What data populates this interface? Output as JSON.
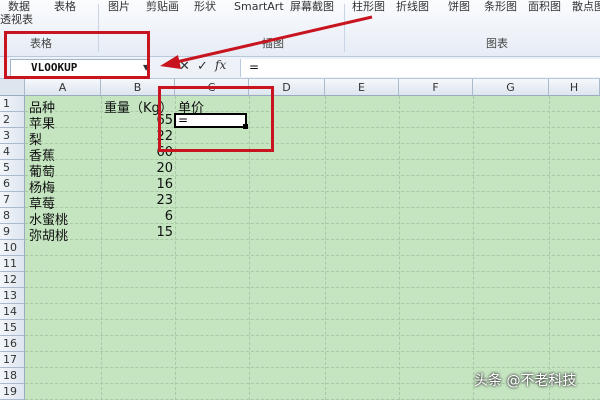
{
  "ribbon": {
    "items_row1": [
      "数据",
      "表格",
      "图片",
      "剪贴画",
      "形状",
      "SmartArt",
      "屏幕截图",
      "柱形图",
      "折线图",
      "饼图",
      "条形图",
      "面积图",
      "散点图"
    ],
    "items_row2": [
      "透视表"
    ],
    "groups": [
      "表格",
      "插图",
      "图表"
    ]
  },
  "formula_bar": {
    "name_box": "VLOOKUP",
    "cancel": "✕",
    "enter": "✓",
    "fx": "fx",
    "formula": "="
  },
  "sheet": {
    "columns": [
      "A",
      "B",
      "C",
      "D",
      "E",
      "F",
      "G",
      "H"
    ],
    "rows": [
      "1",
      "2",
      "3",
      "4",
      "5",
      "6",
      "7",
      "8",
      "9",
      "10",
      "11",
      "12",
      "13",
      "14",
      "15",
      "16",
      "17",
      "18",
      "19"
    ],
    "header": {
      "A": "品种",
      "B": "重量（Kg）",
      "C": "单价"
    },
    "data": [
      {
        "name": "苹果",
        "weight": "65"
      },
      {
        "name": "梨",
        "weight": "22"
      },
      {
        "name": "香蕉",
        "weight": "60"
      },
      {
        "name": "葡萄",
        "weight": "20"
      },
      {
        "name": "杨梅",
        "weight": "16"
      },
      {
        "name": "草莓",
        "weight": "23"
      },
      {
        "name": "水蜜桃",
        "weight": "6"
      },
      {
        "name": "弥胡桃",
        "weight": "15"
      }
    ],
    "active_value": "="
  },
  "watermark": "头条 @不老科技",
  "colors": {
    "sheet_bg": "#c5e5c1",
    "annotation_red": "#c8141e"
  }
}
